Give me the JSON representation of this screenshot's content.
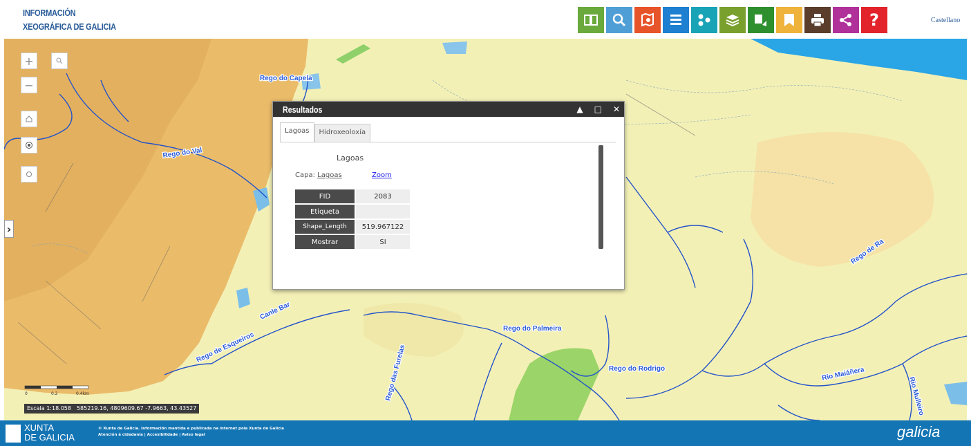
{
  "header": {
    "logo_line1": "INFORMACIÓN",
    "logo_line2": "XEOGRÁFICA DE GALICIA",
    "language": "Castellano",
    "toolbar": [
      {
        "icon": "qr-icon",
        "color": "#6aa93b"
      },
      {
        "icon": "search-icon",
        "color": "#4f9fd6"
      },
      {
        "icon": "map-search-icon",
        "color": "#e8542a"
      },
      {
        "icon": "list-icon",
        "color": "#1f7fd0"
      },
      {
        "icon": "nodes-icon",
        "color": "#19a3b7"
      },
      {
        "icon": "layers-icon",
        "color": "#79a02c"
      },
      {
        "icon": "map-pin-icon",
        "color": "#2e8f2e"
      },
      {
        "icon": "bookmark-icon",
        "color": "#efb23a"
      },
      {
        "icon": "print-icon",
        "color": "#5a3d2b"
      },
      {
        "icon": "share-icon",
        "color": "#b0319a"
      },
      {
        "icon": "help-icon",
        "color": "#e3232b",
        "label": "?"
      }
    ]
  },
  "map": {
    "controls": {
      "zoom_in": "+",
      "zoom_out": "−"
    },
    "labels": [
      "Rego do Capela",
      "Rego do Val",
      "Canle Bar",
      "Rego de Esqueiros",
      "Rego do Palmeira",
      "Rego das Furelas",
      "Rego do Rodrigo",
      "Rego de Ra",
      "Rio Maiáñera",
      "Rio Mulleiro"
    ],
    "scale_text": "Escala 1:18.058",
    "coords_text": "585219.16, 4809609.67 -7.9663, 43.43527",
    "scale_ticks": [
      "0",
      "0.2",
      "0.4km"
    ]
  },
  "popup": {
    "title": "Resultados",
    "tabs": [
      {
        "label": "Lagoas",
        "active": true
      },
      {
        "label": "Hidroxeoloxía",
        "active": false
      }
    ],
    "panel_title": "Lagoas",
    "capa_label": "Capa:",
    "capa_link": "Lagoas",
    "zoom_link": "Zoom",
    "attributes": [
      {
        "key": "FID",
        "value": "2083"
      },
      {
        "key": "Etiqueta",
        "value": ""
      },
      {
        "key": "Shape_Length",
        "value": "519.967122"
      },
      {
        "key": "Mostrar",
        "value": "SI"
      }
    ]
  },
  "footer": {
    "xunta_line1": "XUNTA",
    "xunta_line2": "DE GALICIA",
    "text_line1": "© Xunta de Galicia. Información mantida e publicada na internet pola Xunta de Galicia",
    "text_line2": "Atención á cidadanía | Accesibilidade | Aviso legal",
    "brand": "galicia"
  }
}
